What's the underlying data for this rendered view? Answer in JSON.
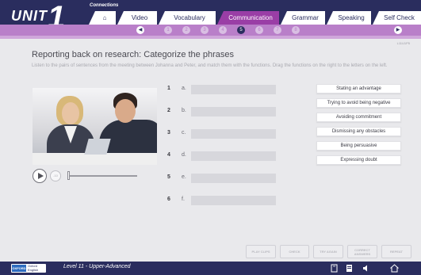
{
  "header": {
    "unit_label": "UNIT",
    "unit_number": "1",
    "section": "Connections",
    "tabs": [
      {
        "label": "⌂",
        "name": "tab-home",
        "active": false
      },
      {
        "label": "Video",
        "name": "tab-video",
        "active": false
      },
      {
        "label": "Vocabulary",
        "name": "tab-vocabulary",
        "active": false
      },
      {
        "label": "Communication",
        "name": "tab-communication",
        "active": true
      },
      {
        "label": "Grammar",
        "name": "tab-grammar",
        "active": false
      },
      {
        "label": "Speaking",
        "name": "tab-speaking",
        "active": false
      },
      {
        "label": "Self Check",
        "name": "tab-self-check",
        "active": false
      }
    ]
  },
  "pager": {
    "prev": "◀",
    "next": "▶",
    "pages": [
      "1",
      "2",
      "3",
      "4",
      "5",
      "6",
      "7",
      "8"
    ],
    "current": "5"
  },
  "page_id": "L11U1P5",
  "title": "Reporting back on research: Categorize the phrases",
  "instructions": "Listen to the pairs of sentences from the meeting between Johanna and Peter, and match them with the functions. Drag the functions on the right to the letters on the left.",
  "player": {
    "rewind": "-10"
  },
  "rows": [
    {
      "num": "1",
      "letter": "a."
    },
    {
      "num": "2",
      "letter": "b."
    },
    {
      "num": "3",
      "letter": "c."
    },
    {
      "num": "4",
      "letter": "d."
    },
    {
      "num": "5",
      "letter": "e."
    },
    {
      "num": "6",
      "letter": "f."
    }
  ],
  "options": [
    "Stating an advantage",
    "Trying to avoid being negative",
    "Avoiding commitment",
    "Dismissing any obstacles",
    "Being persuasive",
    "Expressing doubt"
  ],
  "actions": {
    "play_clips": "PLAY CLIPS",
    "check": "CHECK",
    "try_again": "TRY AGAIN",
    "correct_answers": "CORRECT ANSWERS",
    "repeat": "REPEAT"
  },
  "footer": {
    "logo_badge": "OXFORD",
    "logo_text": "Oxford English",
    "level": "Level 11 - Upper-Advanced",
    "icons": [
      "book-icon",
      "notebook-icon",
      "volume-icon",
      "home-icon"
    ]
  },
  "colors": {
    "navy": "#2a2d5e",
    "purple": "#9a3ea6",
    "lilac": "#b97fc9"
  }
}
